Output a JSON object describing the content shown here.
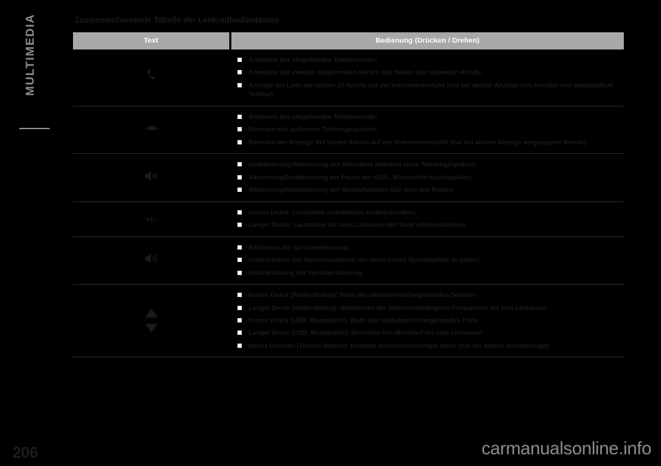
{
  "chapter": {
    "label": "MULTIMEDIA"
  },
  "page": {
    "number": "206",
    "title": "Zusammenfassende Tabelle der Lenkradbedientasten",
    "watermark": "carmanualsonline.info"
  },
  "table": {
    "headers": {
      "text": "Text",
      "operation": "Bedienung (Drücken / Drehen)"
    },
    "rows": [
      {
        "icon": "phone-handset-icon",
        "items": [
          "Annahme des eingehenden Telefonanrufs;",
          "Annahme des zweiten eingehenden Anrufs und Halten des laufenden Anrufs;",
          "Anzeige der Liste der letzten 10 Anrufe auf der Instrumententafel (nur bei aktiver Anzeige von Anrufen und gekoppeltem Telefon)"
        ]
      },
      {
        "icon": "phone-hangup-icon",
        "items": [
          "Ablehnen des eingehenden Telefonanrufs;",
          "Beenden des laufenden Telefongesprächs;",
          "Beenden der Anzeige der letzten Anrufe auf der Instrumententafel (nur bei aktiver Anzeige vergangener Anrufe)"
        ]
      },
      {
        "icon": "microphone-mute-icon",
        "items": [
          "Deaktivierung/Aktivierung des Mikrofons während eines Telefongesprächs;",
          "Aktivierung/Deaktivierung der Pause der USB-, Bluetooth®-Audioquellen;",
          "Aktivierung/Deaktivierung der Stummfunktion (Ein aus) des Radios"
        ]
      },
      {
        "icon": "volume-plus-minus-icon",
        "items": [
          "Kurzer Druck: Lautstärke schrittweise erhöhen/senken;",
          "Langer Druck: Lautstärke bis zum Loslassen der Taste erhöhen/senken"
        ]
      },
      {
        "icon": "voice-recognition-icon",
        "items": [
          "Aktivieren der Spracherkennung;",
          "Unterbrechen der Sprachnachricht, um einen neuen Sprachbefehl zu geben;",
          "Unterbrechung der Spracherkennung"
        ]
      },
      {
        "icon": "up-down-arrows-icon",
        "items": [
          "Kurzer Druck (Radio-Modus): Wahl des nächsten/vorhergehenden Senders",
          "Langer Druck (Radio-Modus): Abstimmen der höheren/niedrigeren Frequenzen bis zum Loslassen",
          "Kurzer Druck (USB, Bluetooth®): Wahl des nächsten/vorhergehenden Titels",
          "Langer Druck (USB, Bluetooth®): Schneller Vor-/Rücklauf bis zum Loslassen",
          "Neues Drücken (Telefon-Modus): Auswahl nächster/vorheriger Anruf (nur bei aktiver Anrufanzeige)"
        ]
      }
    ]
  },
  "colors": {
    "page_background": "#000000",
    "header_fill": "#a8a8a8",
    "text": "#1b1b1b",
    "chapter_tab": "#8e8e8e",
    "watermark": "#8d8d8d"
  }
}
